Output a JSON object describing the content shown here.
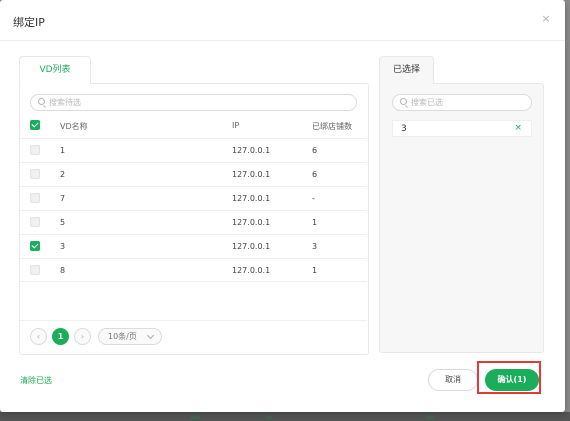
{
  "dialog": {
    "title": "绑定IP",
    "close_glyph": "×"
  },
  "left_panel": {
    "tab_label": "VD列表",
    "search_placeholder": "搜索待选",
    "columns": {
      "name": "VD名称",
      "ip": "IP",
      "count": "已绑店铺数"
    },
    "header_checked": true,
    "rows": [
      {
        "name": "1",
        "ip": "127.0.0.1",
        "count": "6",
        "checked": false
      },
      {
        "name": "2",
        "ip": "127.0.0.1",
        "count": "6",
        "checked": false
      },
      {
        "name": "7",
        "ip": "127.0.0.1",
        "count": "-",
        "checked": false
      },
      {
        "name": "5",
        "ip": "127.0.0.1",
        "count": "1",
        "checked": false
      },
      {
        "name": "3",
        "ip": "127.0.0.1",
        "count": "3",
        "checked": true
      },
      {
        "name": "8",
        "ip": "127.0.0.1",
        "count": "1",
        "checked": false
      }
    ],
    "pagination": {
      "prev_glyph": "‹",
      "current_page": "1",
      "next_glyph": "›",
      "page_size": "10条/页"
    }
  },
  "right_panel": {
    "tab_label": "已选择",
    "search_placeholder": "搜索已选",
    "selected": [
      {
        "label": "3",
        "remove_glyph": "×"
      }
    ]
  },
  "footer": {
    "clear_label": "清除已选",
    "cancel_label": "取消",
    "confirm_label": "确认(1)"
  },
  "colors": {
    "accent": "#1aad5a",
    "highlight": "#e53935"
  }
}
